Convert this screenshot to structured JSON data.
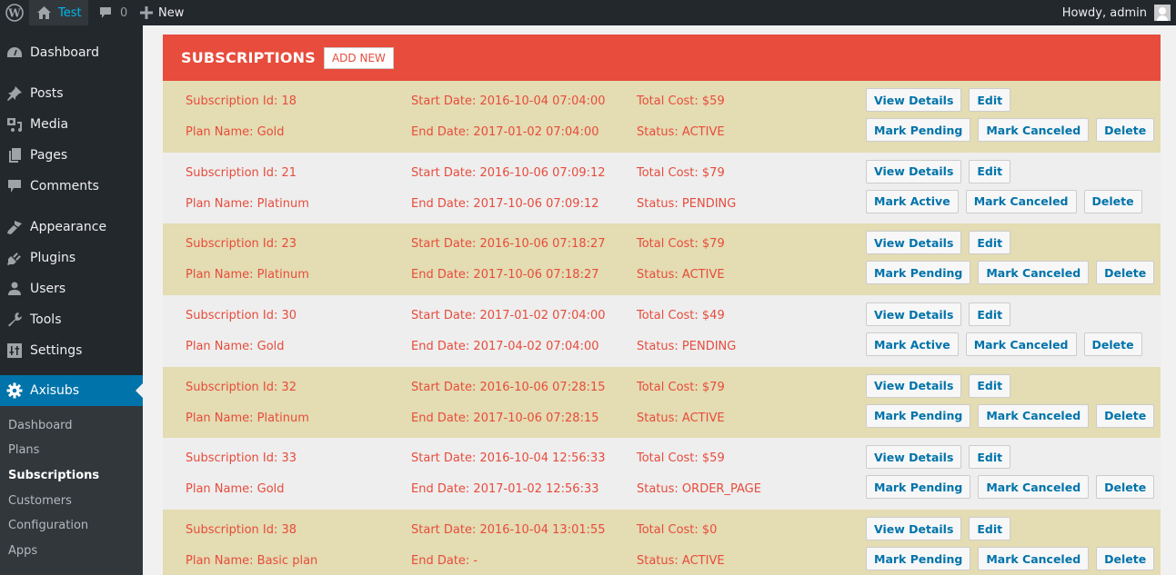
{
  "adminbar": {
    "site_name": "Test",
    "comments_count": "0",
    "new_label": "New",
    "greeting": "Howdy, admin"
  },
  "sidebar": {
    "items": [
      {
        "label": "Dashboard",
        "icon": "dashboard-icon"
      },
      {
        "label": "Posts",
        "icon": "pin-icon"
      },
      {
        "label": "Media",
        "icon": "media-icon"
      },
      {
        "label": "Pages",
        "icon": "pages-icon"
      },
      {
        "label": "Comments",
        "icon": "comment-icon"
      },
      {
        "label": "Appearance",
        "icon": "brush-icon"
      },
      {
        "label": "Plugins",
        "icon": "plug-icon"
      },
      {
        "label": "Users",
        "icon": "user-icon"
      },
      {
        "label": "Tools",
        "icon": "wrench-icon"
      },
      {
        "label": "Settings",
        "icon": "settings-icon"
      },
      {
        "label": "Axisubs",
        "icon": "gear-icon"
      }
    ],
    "submenu": [
      {
        "label": "Dashboard"
      },
      {
        "label": "Plans"
      },
      {
        "label": "Subscriptions"
      },
      {
        "label": "Customers"
      },
      {
        "label": "Configuration"
      },
      {
        "label": "Apps"
      }
    ]
  },
  "main": {
    "title": "SUBSCRIPTIONS",
    "add_new_label": "ADD NEW",
    "colors": {
      "header": "#e74c3c",
      "row_alt": "#e4dcb2",
      "row": "#eeeeee",
      "text": "#e74c3c",
      "button_text": "#0073aa"
    },
    "rows": [
      {
        "id": "Subscription Id: 18",
        "plan": "Plan Name: Gold",
        "start": "Start Date: 2016-10-04 07:04:00",
        "end": "End Date: 2017-01-02 07:04:00",
        "cost": "Total Cost: $59",
        "status": "Status: ACTIVE",
        "view": "View Details",
        "edit": "Edit",
        "mark": "Mark Pending",
        "cancel": "Mark Canceled",
        "delete": "Delete"
      },
      {
        "id": "Subscription Id: 21",
        "plan": "Plan Name: Platinum",
        "start": "Start Date: 2016-10-06 07:09:12",
        "end": "End Date: 2017-10-06 07:09:12",
        "cost": "Total Cost: $79",
        "status": "Status: PENDING",
        "view": "View Details",
        "edit": "Edit",
        "mark": "Mark Active",
        "cancel": "Mark Canceled",
        "delete": "Delete"
      },
      {
        "id": "Subscription Id: 23",
        "plan": "Plan Name: Platinum",
        "start": "Start Date: 2016-10-06 07:18:27",
        "end": "End Date: 2017-10-06 07:18:27",
        "cost": "Total Cost: $79",
        "status": "Status: ACTIVE",
        "view": "View Details",
        "edit": "Edit",
        "mark": "Mark Pending",
        "cancel": "Mark Canceled",
        "delete": "Delete"
      },
      {
        "id": "Subscription Id: 30",
        "plan": "Plan Name: Gold",
        "start": "Start Date: 2017-01-02 07:04:00",
        "end": "End Date: 2017-04-02 07:04:00",
        "cost": "Total Cost: $49",
        "status": "Status: PENDING",
        "view": "View Details",
        "edit": "Edit",
        "mark": "Mark Active",
        "cancel": "Mark Canceled",
        "delete": "Delete"
      },
      {
        "id": "Subscription Id: 32",
        "plan": "Plan Name: Platinum",
        "start": "Start Date: 2016-10-06 07:28:15",
        "end": "End Date: 2017-10-06 07:28:15",
        "cost": "Total Cost: $79",
        "status": "Status: ACTIVE",
        "view": "View Details",
        "edit": "Edit",
        "mark": "Mark Pending",
        "cancel": "Mark Canceled",
        "delete": "Delete"
      },
      {
        "id": "Subscription Id: 33",
        "plan": "Plan Name: Gold",
        "start": "Start Date: 2016-10-04 12:56:33",
        "end": "End Date: 2017-01-02 12:56:33",
        "cost": "Total Cost: $59",
        "status": "Status: ORDER_PAGE",
        "view": "View Details",
        "edit": "Edit",
        "mark": "Mark Pending",
        "cancel": "Mark Canceled",
        "delete": "Delete"
      },
      {
        "id": "Subscription Id: 38",
        "plan": "Plan Name: Basic plan",
        "start": "Start Date: 2016-10-04 13:01:55",
        "end": "End Date: -",
        "cost": "Total Cost: $0",
        "status": "Status: ACTIVE",
        "view": "View Details",
        "edit": "Edit",
        "mark": "Mark Pending",
        "cancel": "Mark Canceled",
        "delete": "Delete"
      }
    ]
  }
}
